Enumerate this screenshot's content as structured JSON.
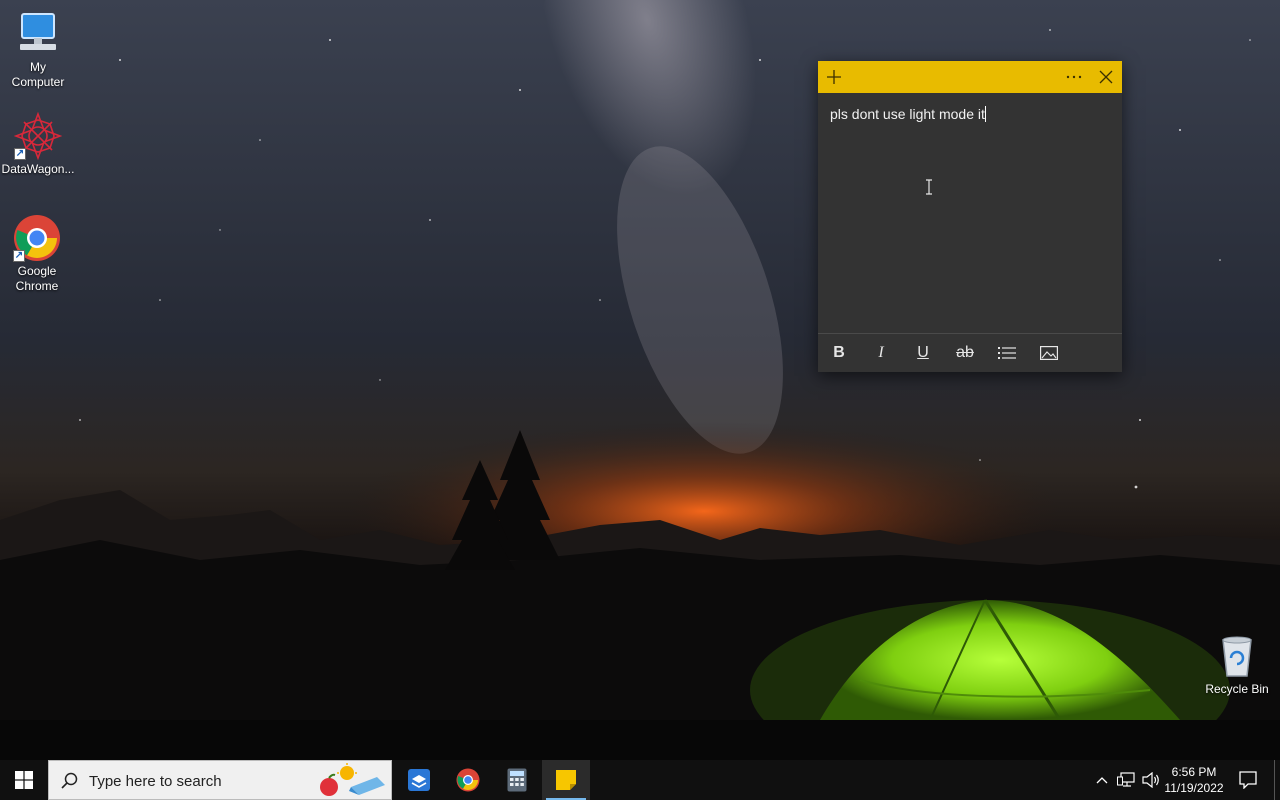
{
  "desktop": {
    "icons": [
      {
        "label_line1": "My",
        "label_line2": "Computer",
        "icon": "computer-icon"
      },
      {
        "label_line1": "DataWagon...",
        "label_line2": "",
        "icon": "datawagon-icon"
      },
      {
        "label_line1": "Google",
        "label_line2": "Chrome",
        "icon": "chrome-icon"
      },
      {
        "label_line1": "Recycle Bin",
        "label_line2": "",
        "icon": "recycle-bin-icon"
      }
    ]
  },
  "sticky_note": {
    "text": "pls dont use light mode it",
    "title_color": "#e8bb00",
    "body_color": "#333333",
    "toolbar": {
      "bold": "B",
      "italic": "I",
      "underline": "U",
      "strikethrough": "ab",
      "list_icon": "bullet-list-icon",
      "image_icon": "insert-image-icon"
    },
    "header": {
      "new_note_icon": "plus-icon",
      "menu_icon": "more-icon",
      "close_icon": "close-icon"
    }
  },
  "taskbar": {
    "search_placeholder": "Type here to search",
    "apps": [
      "dropbox-icon",
      "chrome-icon",
      "calculator-icon",
      "sticky-notes-icon"
    ],
    "active_app": "sticky-notes-icon",
    "clock": {
      "time": "6:56 PM",
      "date": "11/19/2022"
    },
    "accent": "#76b9ed"
  }
}
